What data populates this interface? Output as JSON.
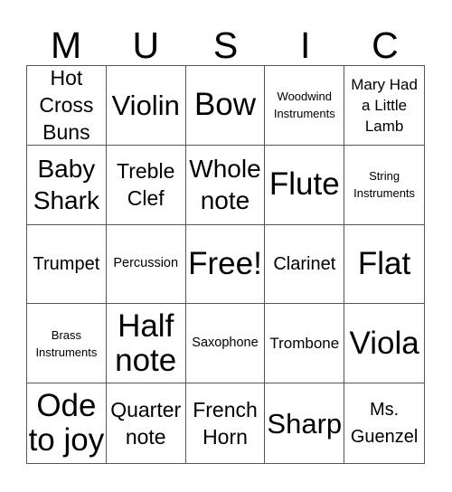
{
  "card": {
    "title_letters": [
      "M",
      "U",
      "S",
      "I",
      "C"
    ],
    "cells": [
      {
        "text": "Hot Cross Buns",
        "size": "s-m"
      },
      {
        "text": "Violin",
        "size": "s-l"
      },
      {
        "text": "Bow",
        "size": "s-xl"
      },
      {
        "text": "Woodwind Instruments",
        "size": "s-xs"
      },
      {
        "text": "Mary Had a Little Lamb",
        "size": "s-sm"
      },
      {
        "text": "Baby Shark",
        "size": "s-lm"
      },
      {
        "text": "Treble Clef",
        "size": "s-m"
      },
      {
        "text": "Whole note",
        "size": "s-lm"
      },
      {
        "text": "Flute",
        "size": "s-xl"
      },
      {
        "text": "String Instruments",
        "size": "s-xs"
      },
      {
        "text": "Trumpet",
        "size": "s-ms"
      },
      {
        "text": "Percussion",
        "size": "s-s"
      },
      {
        "text": "Free!",
        "size": "s-xl"
      },
      {
        "text": "Clarinet",
        "size": "s-ms"
      },
      {
        "text": "Flat",
        "size": "s-xl"
      },
      {
        "text": "Brass Instruments",
        "size": "s-xs"
      },
      {
        "text": "Half note",
        "size": "s-xl"
      },
      {
        "text": "Saxophone",
        "size": "s-s"
      },
      {
        "text": "Trombone",
        "size": "s-sm"
      },
      {
        "text": "Viola",
        "size": "s-xl"
      },
      {
        "text": "Ode to joy",
        "size": "s-xl"
      },
      {
        "text": "Quarter note",
        "size": "s-m"
      },
      {
        "text": "French Horn",
        "size": "s-m"
      },
      {
        "text": "Sharp",
        "size": "s-l"
      },
      {
        "text": "Ms. Guenzel",
        "size": "s-ms"
      }
    ]
  }
}
